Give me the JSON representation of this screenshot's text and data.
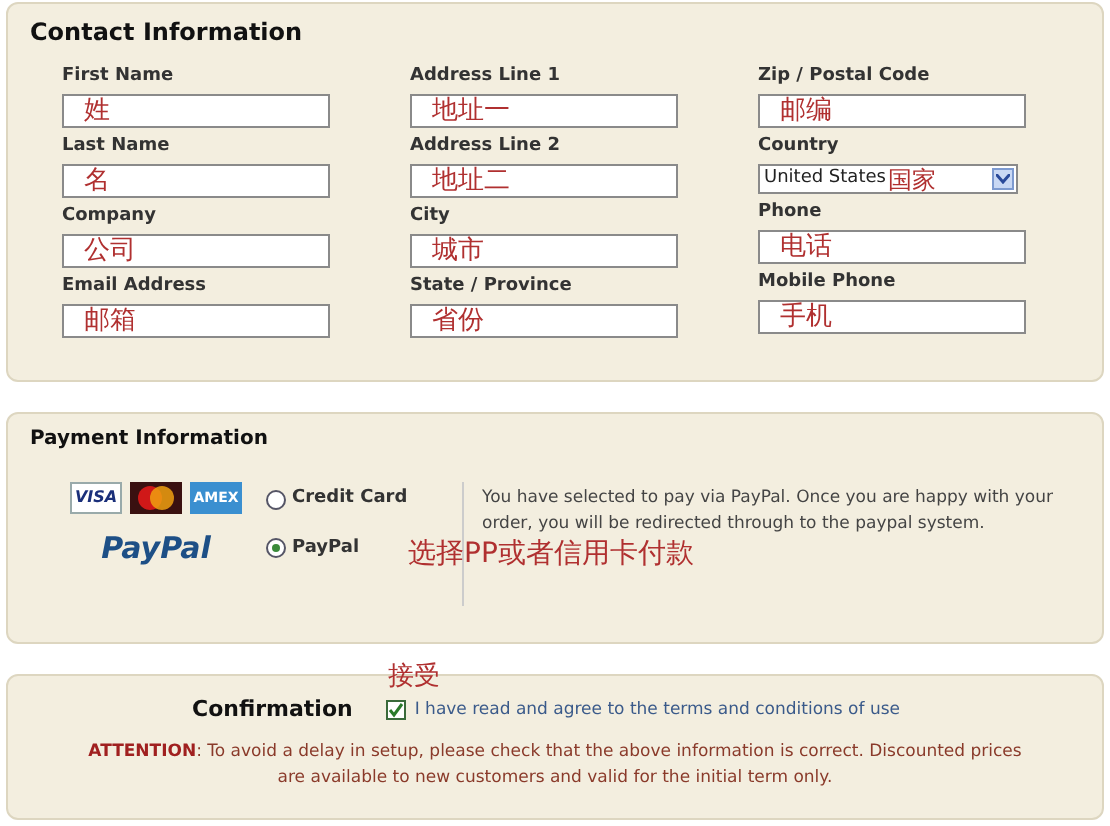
{
  "contact": {
    "title": "Contact Information",
    "columns": [
      [
        {
          "label": "First Name",
          "kind": "text",
          "value": "姓"
        },
        {
          "label": "Last Name",
          "kind": "text",
          "value": "名"
        },
        {
          "label": "Company",
          "kind": "text",
          "value": "公司"
        },
        {
          "label": "Email Address",
          "kind": "text",
          "value": "邮箱"
        }
      ],
      [
        {
          "label": "Address Line 1",
          "kind": "text",
          "value": "地址一"
        },
        {
          "label": "Address Line 2",
          "kind": "text",
          "value": "地址二"
        },
        {
          "label": "City",
          "kind": "text",
          "value": "城市"
        },
        {
          "label": "State / Province",
          "kind": "text",
          "value": "省份"
        }
      ],
      [
        {
          "label": "Zip / Postal Code",
          "kind": "text",
          "value": "邮编"
        },
        {
          "label": "Country",
          "kind": "select",
          "value": "United States",
          "note": "国家"
        },
        {
          "label": "Phone",
          "kind": "text",
          "value": "电话"
        },
        {
          "label": "Mobile Phone",
          "kind": "text",
          "value": "手机"
        }
      ]
    ]
  },
  "payment": {
    "title": "Payment Information",
    "cards": [
      {
        "kind": "visa",
        "label": "VISA"
      },
      {
        "kind": "mastercard"
      },
      {
        "kind": "amex",
        "label": "AMEX"
      }
    ],
    "logo": "PayPal",
    "options": [
      {
        "label": "Credit Card",
        "selected": false
      },
      {
        "label": "PayPal",
        "selected": true
      }
    ],
    "note": "选择PP或者信用卡付款",
    "message": "You have selected to pay via PayPal. Once you are happy with your order, you will be redirected through to the paypal system."
  },
  "confirmation": {
    "title": "Confirmation",
    "note": "接受",
    "agree": {
      "label": "I have read and agree to the terms and conditions of use",
      "checked": true
    },
    "attention_label": "ATTENTION",
    "attention_text": ": To avoid a delay in setup, please check that the above information is correct. Discounted prices are available to new customers and valid for the initial term only."
  }
}
